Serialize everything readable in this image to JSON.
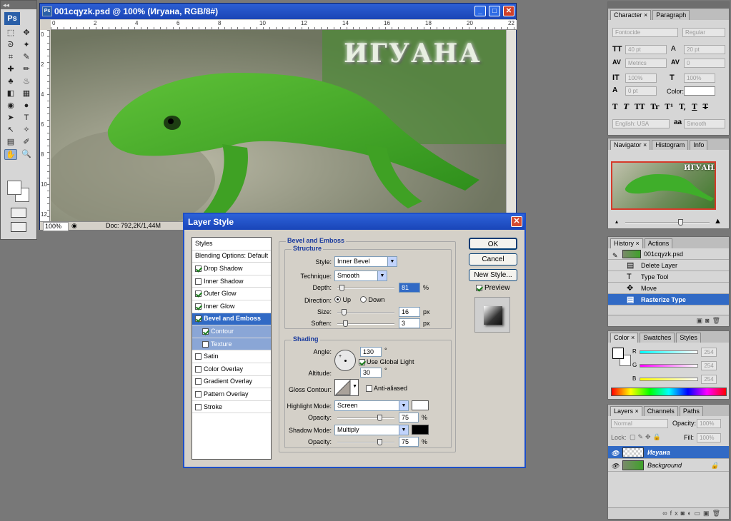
{
  "toolbox": {
    "logo": "Ps",
    "tools": [
      "marquee-icon",
      "move-icon",
      "lasso-icon",
      "magic-wand-icon",
      "crop-icon",
      "slice-icon",
      "healing-icon",
      "brush-icon",
      "stamp-icon",
      "history-brush-icon",
      "eraser-icon",
      "gradient-icon",
      "blur-icon",
      "dodge-icon",
      "path-select-icon",
      "type-icon",
      "direct-select-icon",
      "shape-icon",
      "notes-icon",
      "eyedropper-icon",
      "hand-icon",
      "zoom-icon"
    ],
    "tool_glyphs": [
      "⬚",
      "✥",
      "ᘐ",
      "✦",
      "⌗",
      "✎",
      "✚",
      "✏",
      "♣",
      "♨",
      "◧",
      "▦",
      "◉",
      "●",
      "➤",
      "T",
      "↖",
      "✧",
      "▤",
      "✐",
      "✋",
      "🔍"
    ],
    "fg_color": "#ffffff",
    "bg_color": "#ffffff"
  },
  "document": {
    "title": "001cqyzk.psd @ 100% (Игуана, RGB/8#)",
    "canvas_text": "ИГУАНА",
    "zoom": "100%",
    "doc_size": "Doc: 792,2K/1,44M",
    "ruler_marks": [
      "0",
      "2",
      "4",
      "6",
      "8",
      "10",
      "12",
      "14",
      "16",
      "18",
      "20",
      "22"
    ],
    "vruler_marks": [
      "0",
      "2",
      "4",
      "6",
      "8",
      "10",
      "12"
    ]
  },
  "dialog": {
    "title": "Layer Style",
    "styles_header": "Styles",
    "blending": "Blending Options: Default",
    "items": [
      {
        "label": "Drop Shadow",
        "checked": true
      },
      {
        "label": "Inner Shadow",
        "checked": false
      },
      {
        "label": "Outer Glow",
        "checked": true
      },
      {
        "label": "Inner Glow",
        "checked": true
      },
      {
        "label": "Bevel and Emboss",
        "checked": true,
        "selected": true
      },
      {
        "label": "Contour",
        "checked": true,
        "sub": true
      },
      {
        "label": "Texture",
        "checked": false,
        "sub": true
      },
      {
        "label": "Satin",
        "checked": false
      },
      {
        "label": "Color Overlay",
        "checked": false
      },
      {
        "label": "Gradient Overlay",
        "checked": false
      },
      {
        "label": "Pattern Overlay",
        "checked": false
      },
      {
        "label": "Stroke",
        "checked": false
      }
    ],
    "bevel_title": "Bevel and Emboss",
    "structure_title": "Structure",
    "style_label": "Style:",
    "style_value": "Inner Bevel",
    "technique_label": "Technique:",
    "technique_value": "Smooth",
    "depth_label": "Depth:",
    "depth_value": "81",
    "depth_unit": "%",
    "direction_label": "Direction:",
    "direction_up": "Up",
    "direction_down": "Down",
    "size_label": "Size:",
    "size_value": "16",
    "size_unit": "px",
    "soften_label": "Soften:",
    "soften_value": "3",
    "soften_unit": "px",
    "shading_title": "Shading",
    "angle_label": "Angle:",
    "angle_value": "130",
    "degree": "°",
    "global_light": "Use Global Light",
    "altitude_label": "Altitude:",
    "altitude_value": "30",
    "gloss_label": "Gloss Contour:",
    "anti_aliased": "Anti-aliased",
    "highlight_label": "Highlight Mode:",
    "highlight_value": "Screen",
    "highlight_color": "#ffffff",
    "opacity_label": "Opacity:",
    "highlight_opacity": "75",
    "shadow_label": "Shadow Mode:",
    "shadow_value": "Multiply",
    "shadow_color": "#000000",
    "shadow_opacity": "75",
    "percent": "%",
    "ok": "OK",
    "cancel": "Cancel",
    "new_style": "New Style...",
    "preview": "Preview"
  },
  "character": {
    "tabs": [
      "Character",
      "Paragraph"
    ],
    "font": "Fontocide",
    "font_style": "Regular",
    "size": "40 pt",
    "leading": "20 pt",
    "kerning": "Metrics",
    "tracking": "0",
    "vscale": "100%",
    "hscale": "100%",
    "baseline": "0 pt",
    "color_label": "Color:",
    "styles": [
      "T",
      "T",
      "TT",
      "Tr",
      "T¹",
      "T,",
      "T",
      "T"
    ],
    "language": "English: USA",
    "aa_label": "aa",
    "antialias": "Smooth"
  },
  "navigator": {
    "tabs": [
      "Navigator",
      "Histogram",
      "Info"
    ],
    "thumb_text": "ИГУАНА"
  },
  "history": {
    "tabs": [
      "History",
      "Actions"
    ],
    "snapshot": "001cqyzk.psd",
    "items": [
      {
        "label": "Delete Layer",
        "selected": false
      },
      {
        "label": "Type Tool",
        "selected": false
      },
      {
        "label": "Move",
        "selected": false
      },
      {
        "label": "Rasterize Type",
        "selected": true
      }
    ]
  },
  "color": {
    "tabs": [
      "Color",
      "Swatches",
      "Styles"
    ],
    "channels": [
      {
        "name": "R",
        "value": "254"
      },
      {
        "name": "G",
        "value": "254"
      },
      {
        "name": "B",
        "value": "254"
      }
    ]
  },
  "layers": {
    "tabs": [
      "Layers",
      "Channels",
      "Paths"
    ],
    "blend": "Normal",
    "opacity_label": "Opacity:",
    "opacity": "100%",
    "lock_label": "Lock:",
    "fill_label": "Fill:",
    "fill": "100%",
    "items": [
      {
        "name": "Игуана",
        "selected": true
      },
      {
        "name": "Background",
        "selected": false
      }
    ]
  }
}
